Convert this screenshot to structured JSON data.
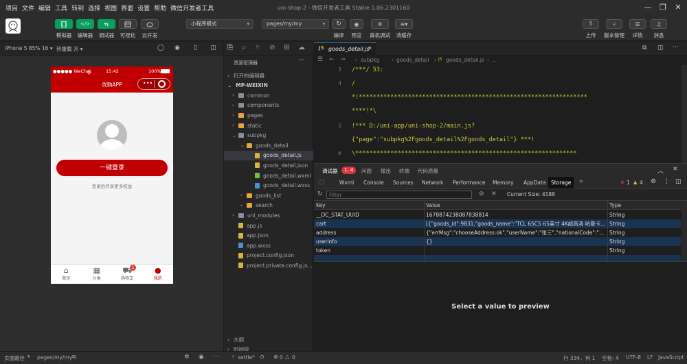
{
  "menubar": {
    "items": [
      "项目",
      "文件",
      "编辑",
      "工具",
      "转到",
      "选择",
      "视图",
      "界面",
      "设置",
      "帮助",
      "微信开发者工具"
    ]
  },
  "window_title": "uni-shop-2 - 微信开发者工具 Stable 1.06.2301160",
  "toolbar": {
    "left_buttons": [
      "模拟器",
      "编辑器",
      "调试器",
      "可视化",
      "云开发"
    ],
    "mode_select": "小程序模式",
    "page_select": "pages/my/my",
    "mid_buttons": [
      "编译",
      "预览",
      "真机调试",
      "清缓存"
    ],
    "right_buttons": [
      "上传",
      "版本管理",
      "详情",
      "消息"
    ]
  },
  "simulator": {
    "device": "iPhone 5 85% 16 ▾",
    "hot_reload": "热重载 开 ▾",
    "status_bar": {
      "carrier": "●●●●● WeChat",
      "wifi": "令",
      "time": "15:42",
      "battery": "100%"
    },
    "nav_title": "优购APP",
    "login_button": "一键登录",
    "login_hint": "登录后尽享更多权益",
    "cart_badge": "1",
    "tabs": [
      {
        "label": "首页",
        "icon": "home-icon",
        "active": false
      },
      {
        "label": "分类",
        "icon": "grid-icon",
        "active": false
      },
      {
        "label": "购物车",
        "icon": "cart-icon",
        "active": false
      },
      {
        "label": "我的",
        "icon": "user-icon",
        "active": true
      }
    ]
  },
  "explorer": {
    "title": "资源管理器",
    "open_editors": "打开的编辑器",
    "root": "MP-WEIXIN",
    "items": [
      {
        "label": "common",
        "type": "folder",
        "indent": 1,
        "color": "#8a8f98"
      },
      {
        "label": "components",
        "type": "folder",
        "indent": 1,
        "color": "#8a8f98"
      },
      {
        "label": "pages",
        "type": "folder",
        "indent": 1,
        "color": "#e8a33e"
      },
      {
        "label": "static",
        "type": "folder",
        "indent": 1,
        "color": "#e8a33e"
      },
      {
        "label": "subpkg",
        "type": "folder",
        "indent": 1,
        "color": "#8a8f98",
        "open": true
      },
      {
        "label": "goods_detail",
        "type": "folder",
        "indent": 2,
        "color": "#e8a33e",
        "open": true
      },
      {
        "label": "goods_detail.js",
        "type": "file",
        "indent": 3,
        "color": "#d9b33a",
        "selected": true
      },
      {
        "label": "goods_detail.json",
        "type": "file",
        "indent": 3,
        "color": "#d9b33a"
      },
      {
        "label": "goods_detail.wxml",
        "type": "file",
        "indent": 3,
        "color": "#7ab648"
      },
      {
        "label": "goods_detail.wxss",
        "type": "file",
        "indent": 3,
        "color": "#4a8fd9"
      },
      {
        "label": "goods_list",
        "type": "folder",
        "indent": 2,
        "color": "#e8a33e"
      },
      {
        "label": "search",
        "type": "folder",
        "indent": 2,
        "color": "#e8a33e"
      },
      {
        "label": "uni_modules",
        "type": "folder",
        "indent": 1,
        "color": "#8a8f98"
      },
      {
        "label": "app.js",
        "type": "file",
        "indent": 1,
        "color": "#d9b33a"
      },
      {
        "label": "app.json",
        "type": "file",
        "indent": 1,
        "color": "#d9b33a"
      },
      {
        "label": "app.wxss",
        "type": "file",
        "indent": 1,
        "color": "#4a8fd9"
      },
      {
        "label": "project.config.json",
        "type": "file",
        "indent": 1,
        "color": "#d9b33a"
      },
      {
        "label": "project.private.config.js...",
        "type": "file",
        "indent": 1,
        "color": "#d9b33a"
      }
    ],
    "outline": "大纲",
    "timeline": "时间线"
  },
  "editor": {
    "tab": "goods_detail.js",
    "breadcrumb": [
      "subpkg",
      "goods_detail",
      "goods_detail.js",
      "..."
    ],
    "lines": [
      {
        "n": "3",
        "text": "/***/ 53:"
      },
      {
        "n": "4",
        "text": "/"
      },
      {
        "n": "",
        "text": "*!*****************************************************************"
      },
      {
        "n": "",
        "text": "****!*\\"
      },
      {
        "n": "5",
        "text": "  !*** D:/uni-app/uni-shop-2/main.js?"
      },
      {
        "n": "",
        "text": "  {\"page\":\"subpkg%2Fgoods_detail%2Fgoods_detail\"} ***!"
      },
      {
        "n": "6",
        "text": "  \\***************************************************************"
      }
    ]
  },
  "devtools": {
    "title": "调试器",
    "badge": "1, 4",
    "top_tabs": [
      "问题",
      "输出",
      "终端",
      "代码质量"
    ],
    "tabs": [
      "Wxml",
      "Console",
      "Sources",
      "Network",
      "Performance",
      "Memory",
      "AppData",
      "Storage"
    ],
    "active_tab": "Storage",
    "errors": "1",
    "warnings": "4",
    "filter_placeholder": "Filter",
    "current_size": "Current Size: 4188",
    "columns": [
      "Key",
      "Value",
      "Type"
    ],
    "rows": [
      {
        "key": "__DC_STAT_UUID",
        "value": "1678874238087838814",
        "type": "String"
      },
      {
        "key": "cart",
        "value": "[{\"goods_id\":9831,\"goods_name\":\"TCL 65C5 65英寸 4K超高清 哈曼卡顿音...",
        "type": "String"
      },
      {
        "key": "address",
        "value": "{\"errMsg\":\"chooseAddress:ok\",\"userName\":\"张三\",\"nationalCode\":\"510000...",
        "type": "String"
      },
      {
        "key": "userinfo",
        "value": "{}",
        "type": "String"
      },
      {
        "key": "token",
        "value": "",
        "type": "String"
      },
      {
        "key": "",
        "value": "",
        "type": ""
      }
    ],
    "preview": "Select a value to preview"
  },
  "statusbar": {
    "page_path_label": "页面路径",
    "page_path": "pages/my/my",
    "branch": "settle*",
    "errors": "0",
    "warnings": "0",
    "cursor": "行 334，列 1",
    "spaces": "空格: 4",
    "encoding": "UTF-8",
    "eol": "LF",
    "lang": "JavaScript"
  }
}
